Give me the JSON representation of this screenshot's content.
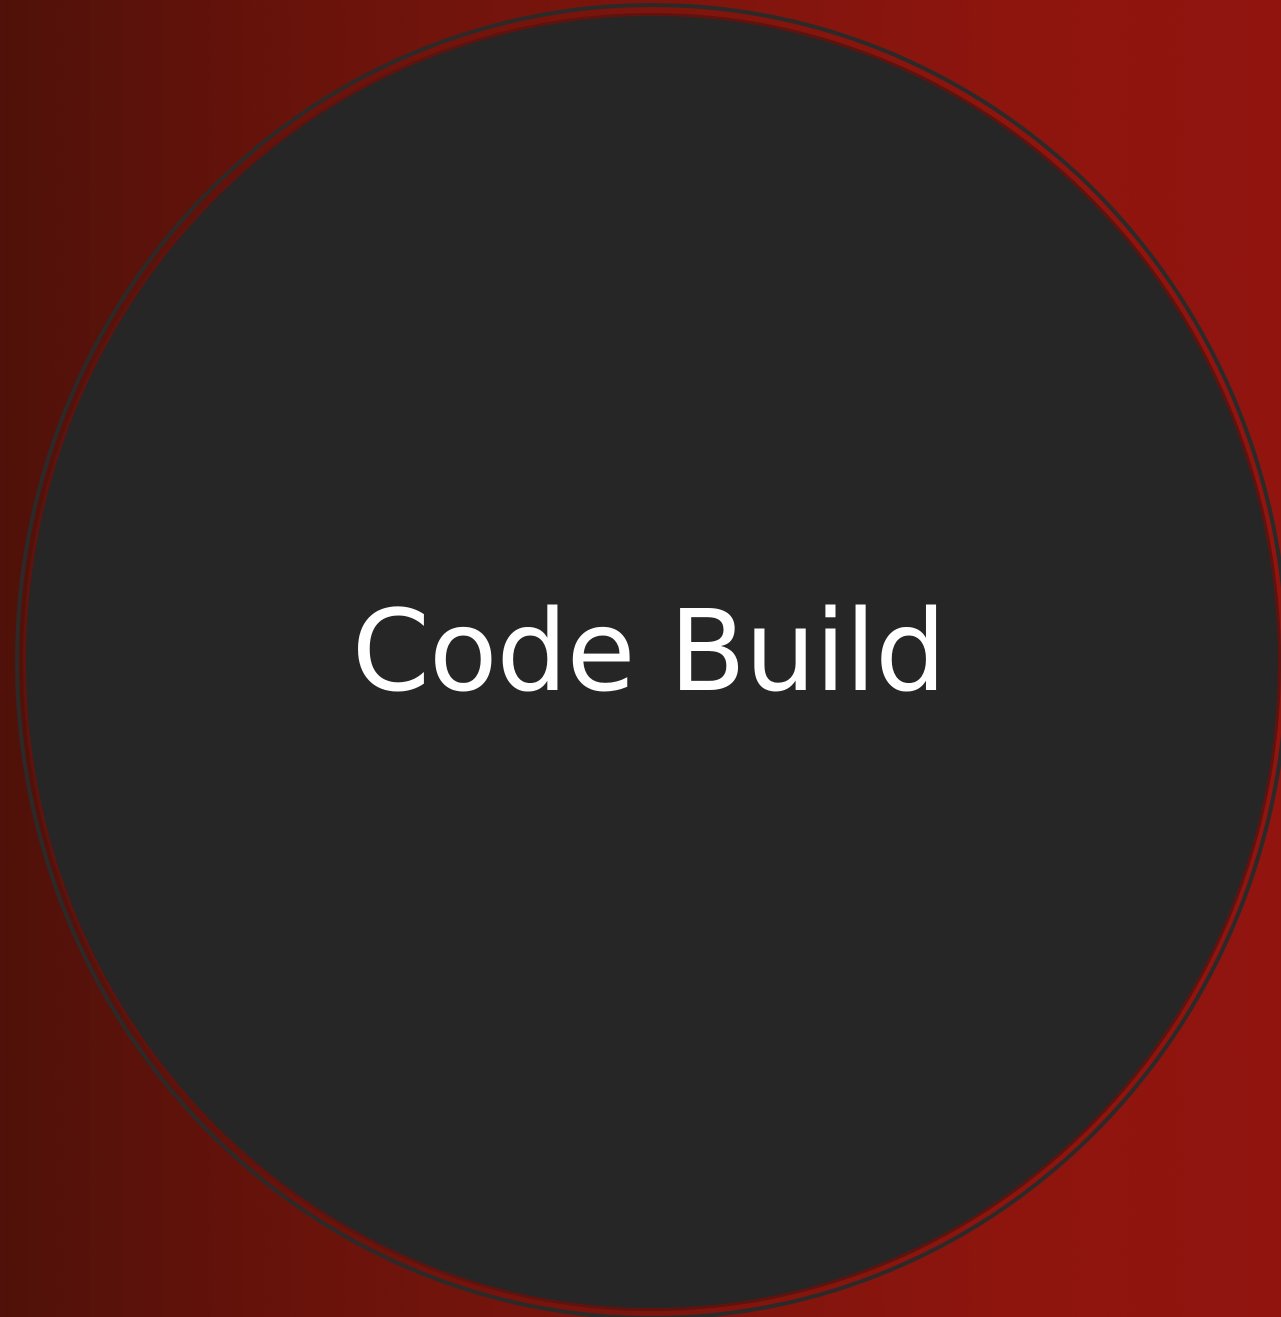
{
  "slide": {
    "title": "Code Build"
  },
  "colors": {
    "background_left": "#4f1109",
    "background_right": "#91140f",
    "disc": "#262626",
    "ring": "#2c2929",
    "text": "#ffffff"
  }
}
